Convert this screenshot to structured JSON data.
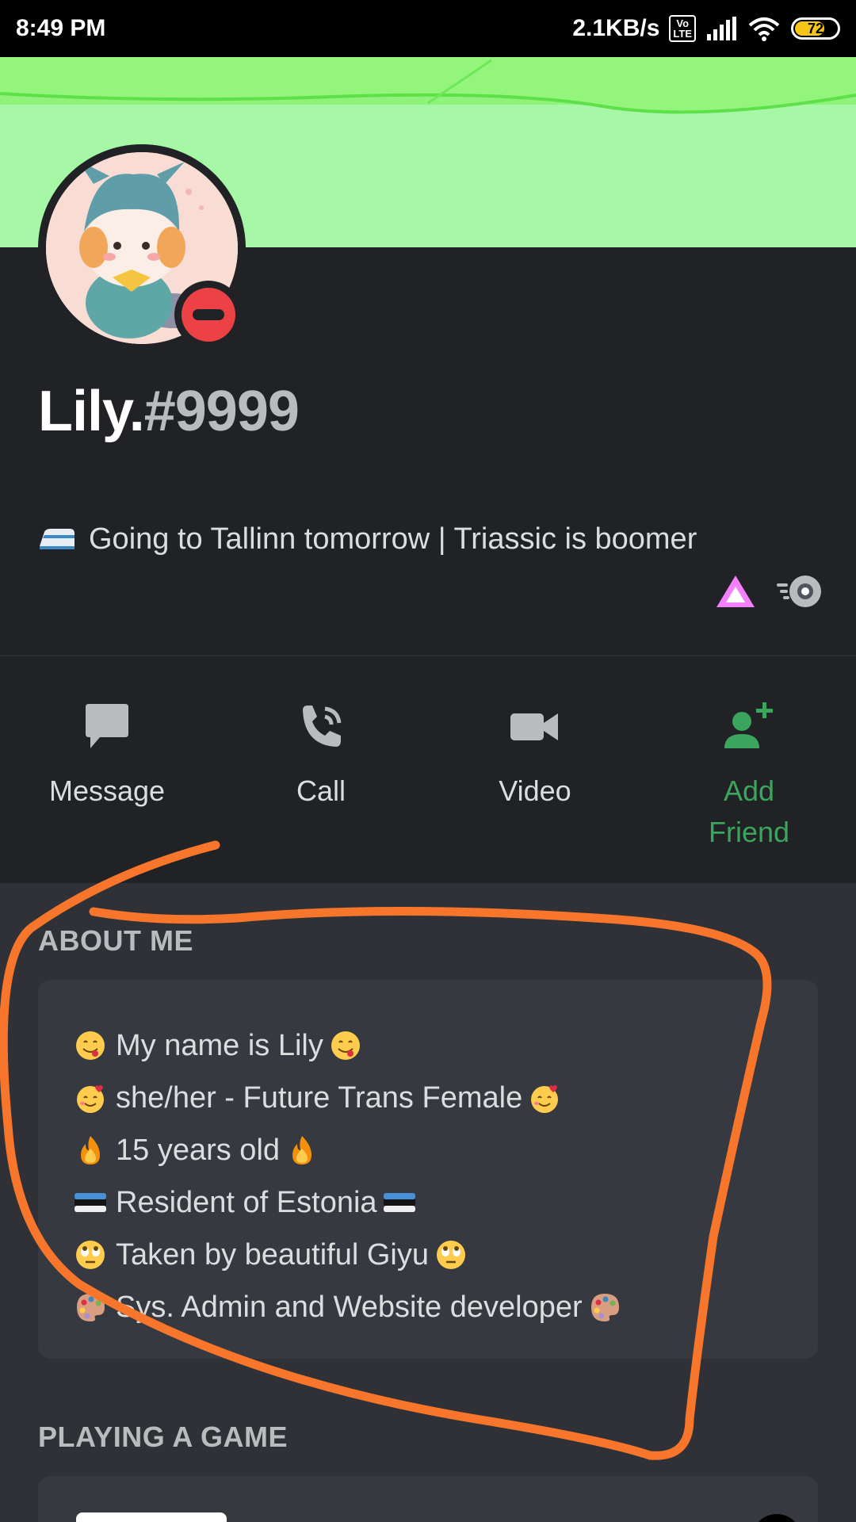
{
  "status_bar": {
    "time": "8:49 PM",
    "network_speed": "2.1KB/s",
    "volte": "Vo LTE",
    "battery": "72",
    "battery_level": 0.72,
    "icons": [
      "volte-icon",
      "signal-icon",
      "wifi-icon",
      "battery-icon"
    ]
  },
  "profile": {
    "username": "Lily.",
    "discriminator": "#9999",
    "status": "dnd",
    "banner_color": "#a6f7a6",
    "custom_status_emoji": "train-icon",
    "custom_status": "Going to Tallinn tomorrow | Triassic is boomer",
    "badges": [
      "hypesquad-balance-icon",
      "nitro-icon"
    ]
  },
  "actions": [
    {
      "label": "Message",
      "icon": "message-icon"
    },
    {
      "label": "Call",
      "icon": "call-icon"
    },
    {
      "label": "Video",
      "icon": "video-icon"
    },
    {
      "label": "Add Friend",
      "icon": "add-friend-icon",
      "color": "#3ba55d"
    }
  ],
  "about_me": {
    "title": "ABOUT ME",
    "lines": [
      {
        "emoji": "yum-emoji",
        "text": "My name is Lily"
      },
      {
        "emoji": "smiling-hearts-emoji",
        "text": "she/her - Future Trans Female"
      },
      {
        "emoji": "fire-emoji",
        "text": "15 years old"
      },
      {
        "emoji": "estonia-flag-emoji",
        "text": "Resident of Estonia"
      },
      {
        "emoji": "eye-roll-emoji",
        "text": "Taken by beautiful Giyu"
      },
      {
        "emoji": "palette-emoji",
        "text": "Sys. Admin and Website developer"
      }
    ]
  },
  "playing": {
    "title": "PLAYING A GAME"
  },
  "annotation_color": "#f7762b"
}
